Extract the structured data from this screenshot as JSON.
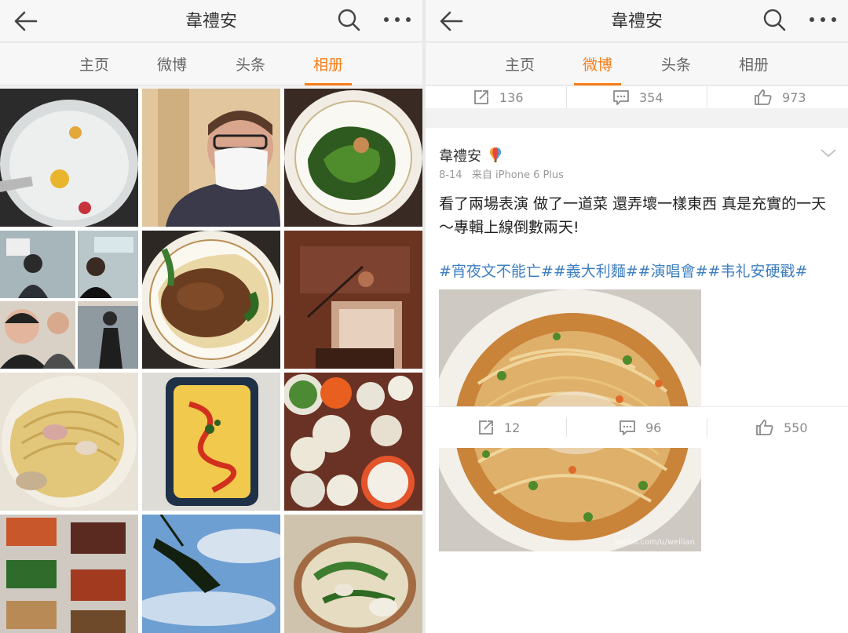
{
  "left": {
    "title": "韋禮安",
    "tabs": [
      "主页",
      "微博",
      "头条",
      "相册"
    ],
    "active_tab": "相册"
  },
  "right": {
    "title": "韋禮安",
    "tabs": [
      "主页",
      "微博",
      "头条",
      "相册"
    ],
    "active_tab": "微博",
    "prev_post": {
      "reposts": "136",
      "comments": "354",
      "likes": "973"
    },
    "post": {
      "author": "韋禮安",
      "date": "8-14",
      "source": "来自 iPhone 6 Plus",
      "text": "看了兩場表演 做了一道菜 還弄壞一樣東西 真是充實的一天～專輯上線倒數兩天!",
      "tags": "#宵夜文不能亡##義大利麵##演唱會##韦礼安硬戳#",
      "watermark": "weibo.com/u/weilian",
      "reposts": "12",
      "comments": "96",
      "likes": "550"
    }
  },
  "icons": [
    "back-arrow-icon",
    "search-icon",
    "more-icon",
    "repost-icon",
    "comment-icon",
    "like-icon",
    "chevron-down-icon",
    "rainbow-badge-icon"
  ],
  "colors": {
    "accent": "#f77c16",
    "link": "#3e7fc1",
    "page_bg": "#f2f2f2"
  }
}
